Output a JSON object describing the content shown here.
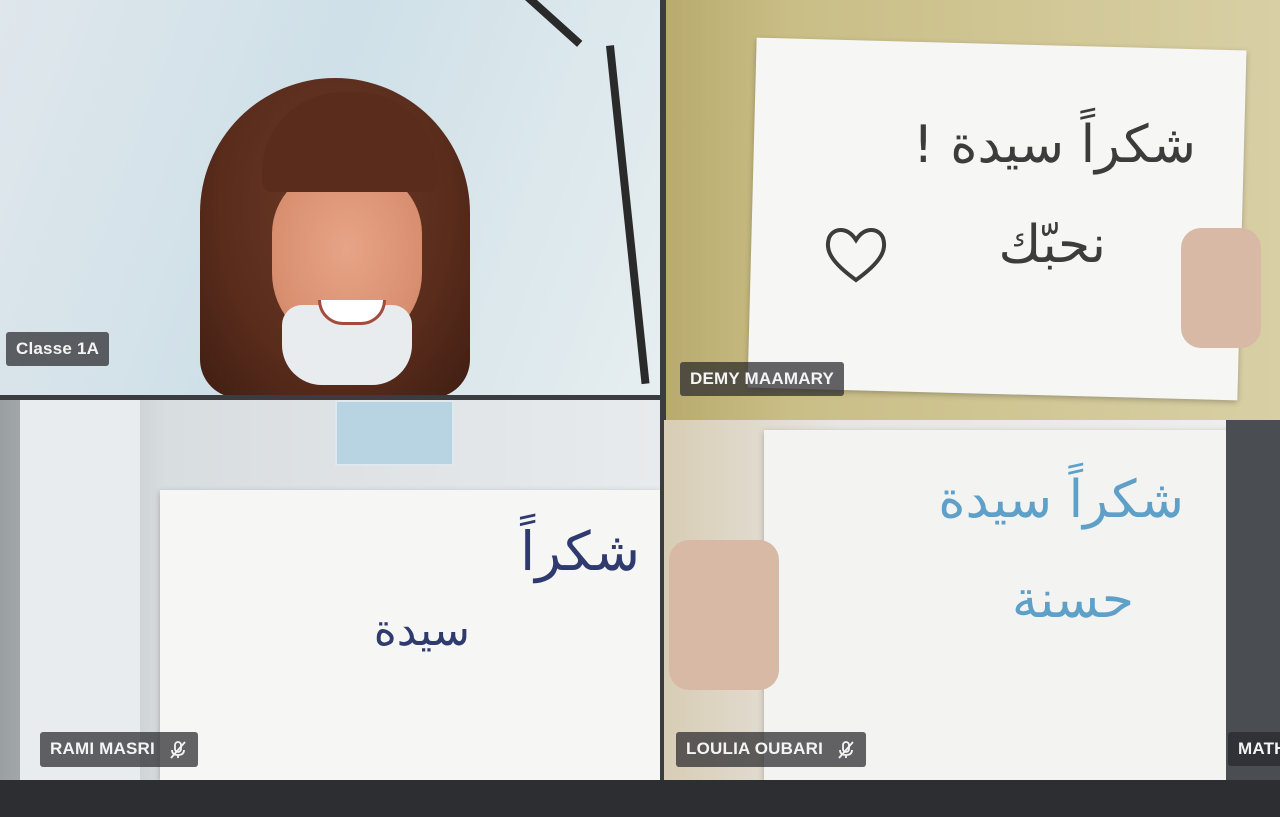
{
  "participants": [
    {
      "id": "p1",
      "name": "Classe 1A",
      "muted": false
    },
    {
      "id": "p2",
      "name": "DEMY MAAMARY",
      "muted": false,
      "sign_line1": "شكراً سيدة !",
      "sign_line2": "نحبّك"
    },
    {
      "id": "p3",
      "name": "RAMI MASRI",
      "muted": true,
      "sign_line1": "شكراً",
      "sign_line2": "سيدة"
    },
    {
      "id": "p4",
      "name": "LOULIA OUBARI",
      "muted": true,
      "sign_line1": "شكراً سيدة",
      "sign_line2": "حسنة"
    },
    {
      "id": "p5",
      "name": "MATH",
      "muted": false
    }
  ],
  "icons": {
    "mute": "mic-off-icon",
    "heart": "heart-icon"
  },
  "colors": {
    "tag_bg": "#28282c",
    "tag_text": "#f4f4f4",
    "background": "#3a3c40"
  }
}
